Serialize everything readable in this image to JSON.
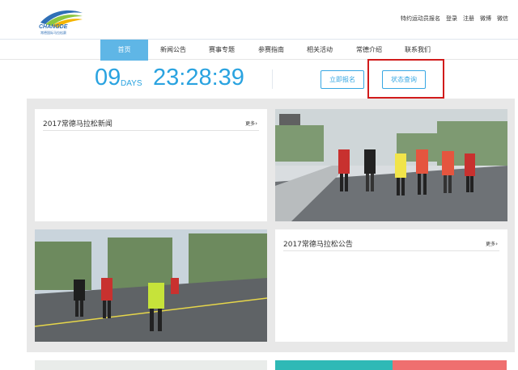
{
  "brand": {
    "name": "CHANGDE",
    "tagline": "常德国际马拉松赛"
  },
  "colors": {
    "accent": "#2aa3e0",
    "nav_active": "#5fb6e6",
    "highlight": "#d11b1b"
  },
  "top_links": [
    "特约运动员报名",
    "登录",
    "注册",
    "微博",
    "微信"
  ],
  "nav": {
    "items": [
      {
        "label": "首页",
        "active": true
      },
      {
        "label": "新闻公告"
      },
      {
        "label": "赛事专题"
      },
      {
        "label": "参赛指南"
      },
      {
        "label": "相关活动"
      },
      {
        "label": "常德介绍"
      },
      {
        "label": "联系我们"
      }
    ]
  },
  "countdown": {
    "days": "09",
    "days_label": "DAYS",
    "time": "23:28:39"
  },
  "buttons": {
    "register": "立即报名",
    "status": "状态查询"
  },
  "cards": {
    "news": {
      "title": "2017常德马拉松新闻",
      "more": "更多"
    },
    "notice": {
      "title": "2017常德马拉松公告",
      "more": "更多"
    }
  }
}
